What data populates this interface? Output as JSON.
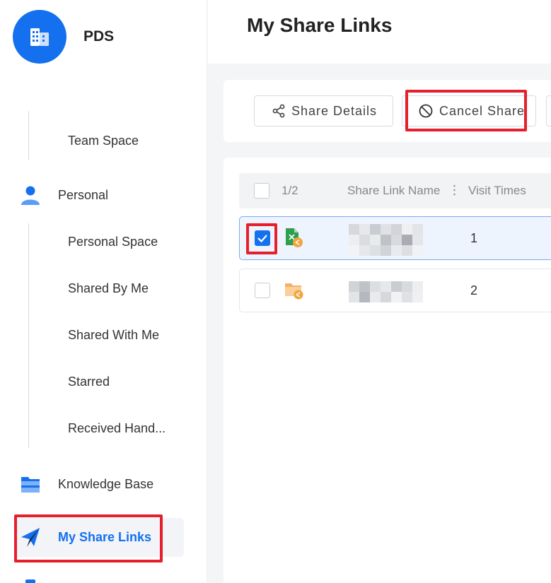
{
  "app": {
    "brand": "PDS"
  },
  "sidebar": {
    "team_space": "Team Space",
    "personal": {
      "label": "Personal",
      "items": [
        "Personal Space",
        "Shared By Me",
        "Shared With Me",
        "Starred",
        "Received Hand..."
      ]
    },
    "knowledge_base": "Knowledge Base",
    "my_share_links": "My Share Links"
  },
  "header": {
    "title": "My Share Links"
  },
  "toolbar": {
    "share_details_label": "Share Details",
    "cancel_share_label": "Cancel Share"
  },
  "table": {
    "selection_count": "1/2",
    "columns": [
      "Share Link Name",
      "Visit Times"
    ],
    "rows": [
      {
        "type": "file",
        "selected": true,
        "visit_times": "1"
      },
      {
        "type": "folder",
        "selected": false,
        "visit_times": "2"
      }
    ]
  },
  "colors": {
    "accent": "#1570ef",
    "highlight": "#e5202c"
  }
}
